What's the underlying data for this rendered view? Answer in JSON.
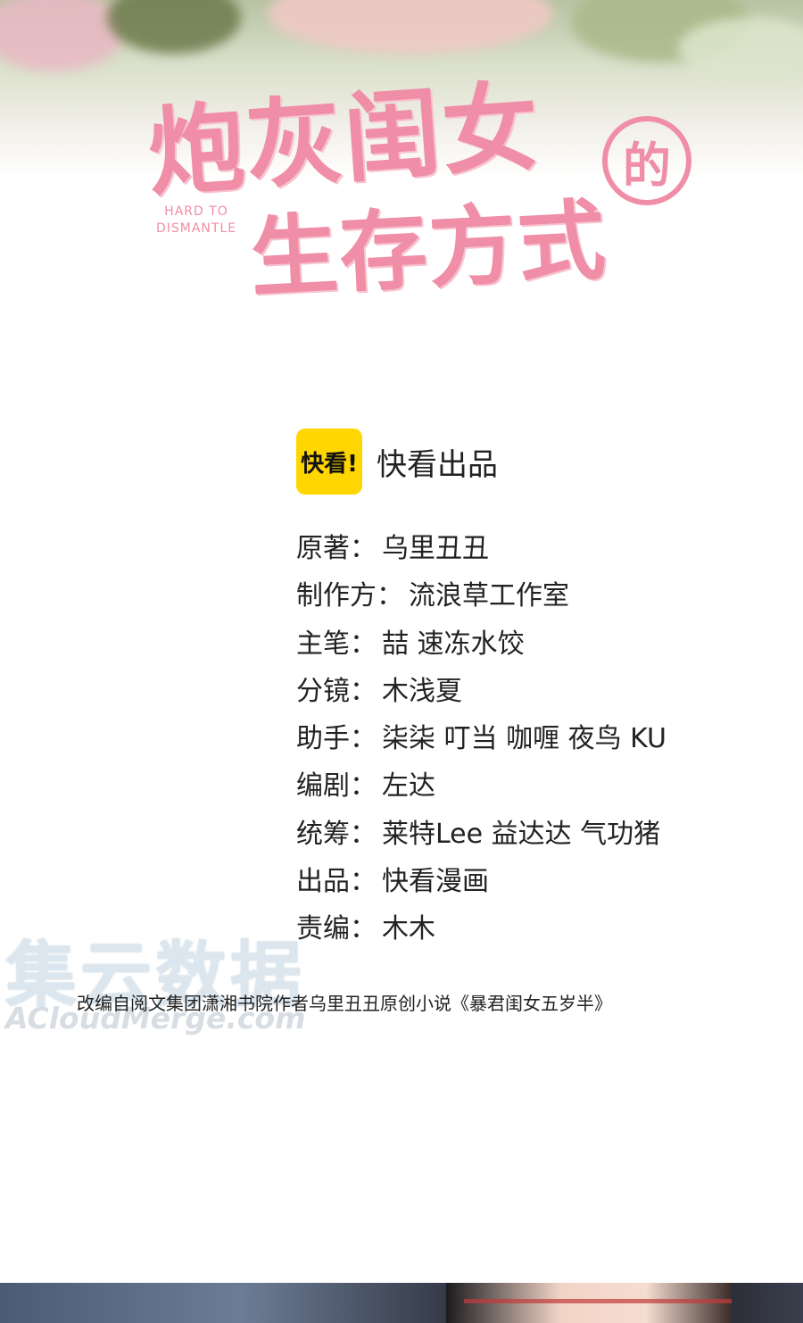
{
  "title": {
    "line1": "炮灰闺女",
    "de": "的",
    "line2": "生存方式",
    "english_line1": "HARD TO",
    "english_line2": "DISMANTLE"
  },
  "publisher": {
    "logo_text": "快看!",
    "text": "快看出品"
  },
  "credits": [
    {
      "label": "原著：",
      "value": "乌里丑丑"
    },
    {
      "label": "制作方：",
      "value": "流浪草工作室"
    },
    {
      "label": "主笔：",
      "value": "喆 速冻水饺"
    },
    {
      "label": "分镜：",
      "value": "木浅夏"
    },
    {
      "label": "助手：",
      "value": "柒柒 叮当 咖喱 夜鸟 KU"
    },
    {
      "label": "编剧：",
      "value": "左达"
    },
    {
      "label": "统筹：",
      "value": "莱特Lee 益达达 气功猪"
    },
    {
      "label": "出品：",
      "value": "快看漫画"
    },
    {
      "label": "责编：",
      "value": "木木"
    }
  ],
  "watermark": {
    "cn": "集云数据",
    "en": "ACloudMerge.com"
  },
  "adaptation_note": "改编自阅文集团潇湘书院作者乌里丑丑原创小说《暴君闺女五岁半》",
  "colors": {
    "title_pink": "#ef8ea6",
    "logo_yellow": "#ffd600",
    "text": "#222222"
  }
}
